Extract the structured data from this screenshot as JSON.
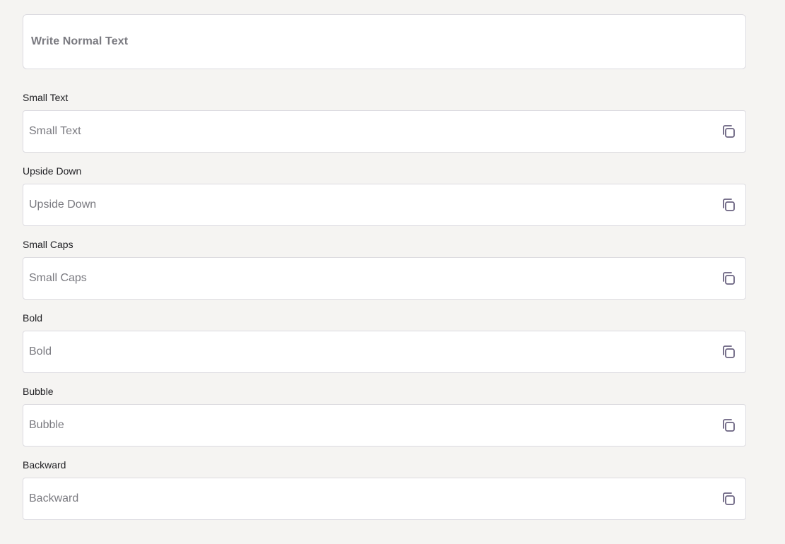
{
  "main_input": {
    "placeholder": "Write Normal Text"
  },
  "fields": [
    {
      "label": "Small Text",
      "value": "Small Text"
    },
    {
      "label": "Upside Down",
      "value": "Upside Down"
    },
    {
      "label": "Small Caps",
      "value": "Small Caps"
    },
    {
      "label": "Bold",
      "value": "Bold"
    },
    {
      "label": "Bubble",
      "value": "Bubble"
    },
    {
      "label": "Backward",
      "value": "Backward"
    }
  ],
  "icons": {
    "copy": "copy-icon"
  },
  "colors": {
    "background": "#f5f4f2",
    "field_border": "#dcdbe0",
    "icon": "#6a6280",
    "placeholder_text": "#7a7a80",
    "label_text": "#1e1e22"
  }
}
